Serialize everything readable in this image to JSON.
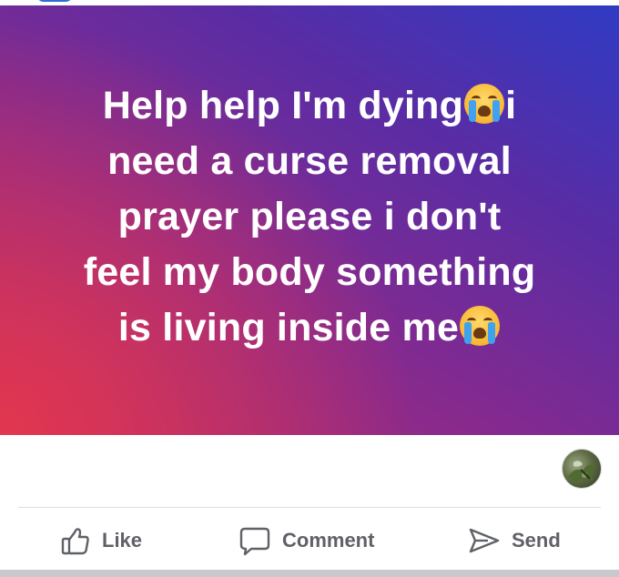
{
  "post": {
    "text_lines": [
      "Help help I'm dying",
      "i",
      "need a curse removal",
      "prayer please i don't",
      "feel my body something",
      "is living inside me"
    ],
    "emoji": "loudly-crying-face"
  },
  "actions": {
    "like": {
      "label": "Like",
      "icon": "thumbs-up-icon"
    },
    "comment": {
      "label": "Comment",
      "icon": "speech-bubble-icon"
    },
    "send": {
      "label": "Send",
      "icon": "paper-plane-icon"
    }
  },
  "colors": {
    "gradient_top_right": "#2f3bc4",
    "gradient_mid": "#8a2a8c",
    "gradient_bottom_left": "#e2364f",
    "action_text": "#5f6167"
  }
}
